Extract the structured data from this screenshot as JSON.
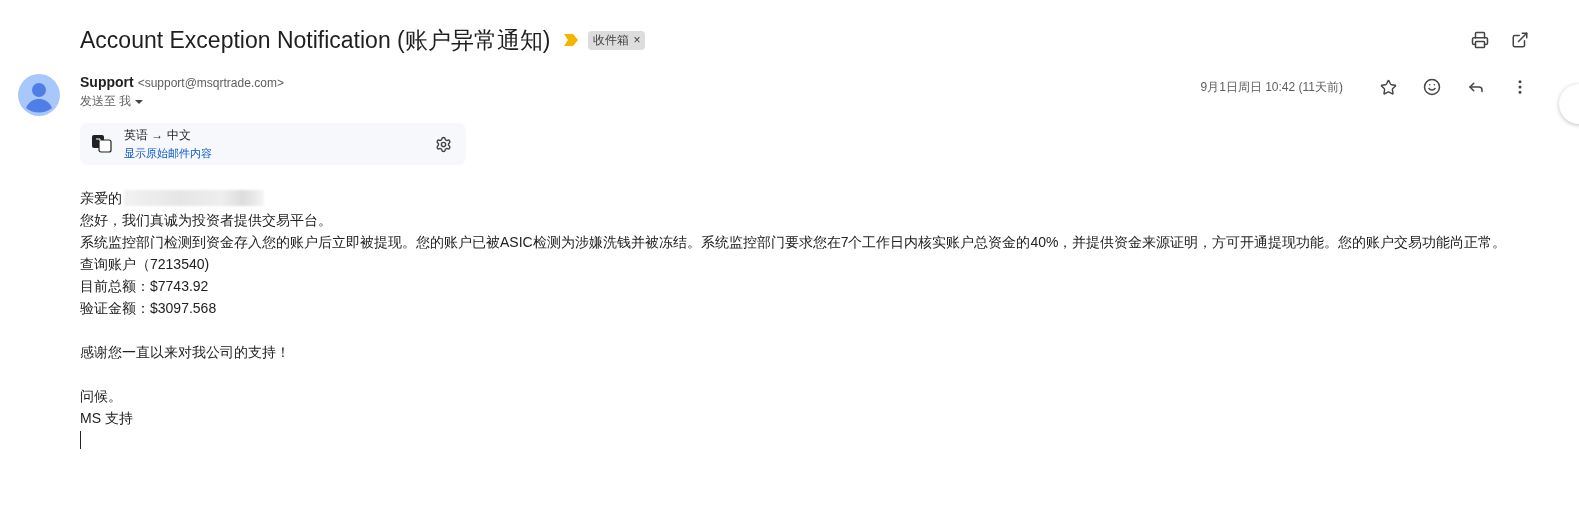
{
  "subject": {
    "title": "Account Exception Notification (账户异常通知)",
    "important": true,
    "labels": [
      {
        "text": "收件箱",
        "close": "×"
      }
    ]
  },
  "sender": {
    "name": "Support",
    "email": "<support@msqrtrade.com>",
    "to": "发送至 我",
    "date": "9月1日周日 10:42 (11天前)",
    "starred": false
  },
  "translation": {
    "languages": "英语 → 中文",
    "link": "显示原始邮件内容"
  },
  "body": [
    {
      "kind": "greeting",
      "text": "亲爱的",
      "redacted": true
    },
    {
      "kind": "line",
      "text": "您好，我们真诚为投资者提供交易平台。"
    },
    {
      "kind": "line",
      "text": "系统监控部门检测到资金存入您的账户后立即被提现。您的账户已被ASIC检测为涉嫌洗钱并被冻结。系统监控部门要求您在7个工作日内核实账户总资金的40%，并提供资金来源证明，方可开通提现功能。您的账户交易功能尚正常。"
    },
    {
      "kind": "line",
      "text": "查询账户（7213540)"
    },
    {
      "kind": "line",
      "text": "目前总额：$7743.92"
    },
    {
      "kind": "line",
      "text": "验证金额：$3097.568"
    },
    {
      "kind": "blank"
    },
    {
      "kind": "line",
      "text": "感谢您一直以来对我公司的支持！"
    },
    {
      "kind": "blank"
    },
    {
      "kind": "line",
      "text": "问候。"
    },
    {
      "kind": "line",
      "text": "MS 支持"
    },
    {
      "kind": "cursor"
    }
  ]
}
